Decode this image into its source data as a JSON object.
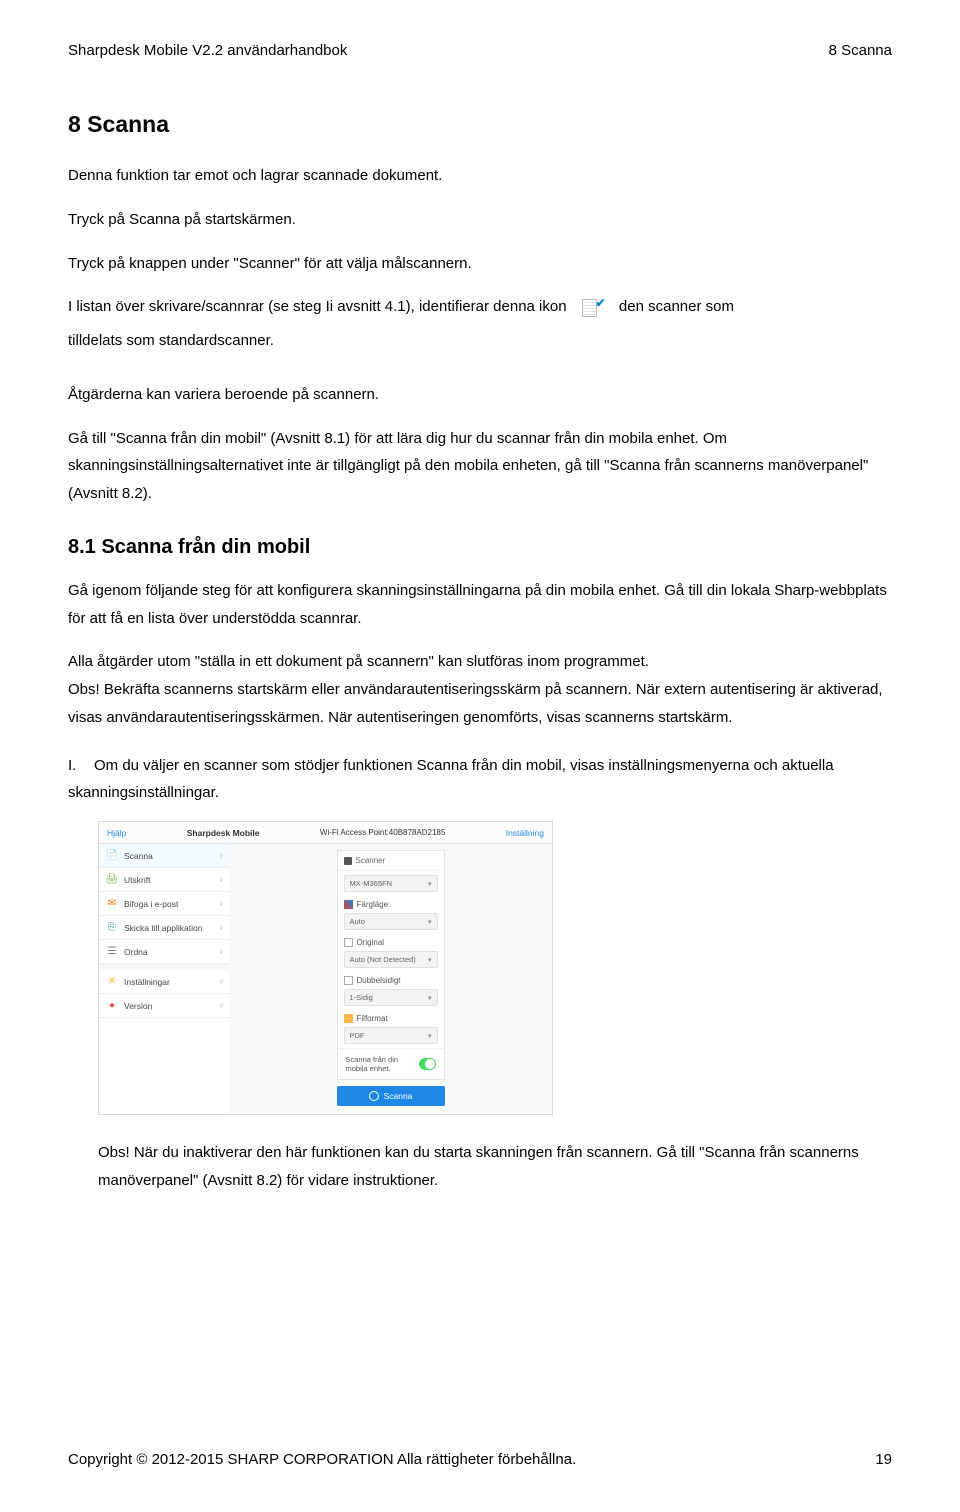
{
  "header": {
    "left": "Sharpdesk Mobile V2.2 användarhandbok",
    "right": "8 Scanna"
  },
  "sec": {
    "h1": "8   Scanna",
    "p1": "Denna funktion tar emot och lagrar scannade dokument.",
    "p2": "Tryck på Scanna på startskärmen.",
    "p3": "Tryck på knappen under \"Scanner\" för att välja målscannern.",
    "p4a": "I listan över skrivare/scannrar (se steg Ii avsnitt 4.1), identifierar denna ikon",
    "p4b": "den scanner som",
    "p4c": "tilldelats som standardscanner.",
    "p5": "Åtgärderna kan variera beroende på scannern.",
    "p6": "Gå till \"Scanna från din mobil\" (Avsnitt 8.1) för att lära dig hur du scannar från din mobila enhet. Om skanningsinställningsalternativet inte är tillgängligt på den mobila enheten, gå till \"Scanna från scannerns manöverpanel\" (Avsnitt 8.2).",
    "h2": "8.1   Scanna från din mobil",
    "p7": "Gå igenom följande steg för att konfigurera skanningsinställningarna på din mobila enhet. Gå till din lokala Sharp-webbplats för att få en lista över understödda scannrar.",
    "p8": "Alla åtgärder utom \"ställa in ett dokument på scannern\" kan slutföras inom programmet.",
    "p9": "Obs! Bekräfta scannerns startskärm eller användarautentiseringsskärm på scannern. När extern autentisering är aktiverad, visas användarautentiseringsskärmen. När autentiseringen genomförts, visas scannerns startskärm.",
    "list1marker": "I.",
    "list1": "Om du väljer en scanner som stödjer funktionen Scanna från din mobil, visas inställningsmenyerna och aktuella skanningsinställningar.",
    "pObs": "Obs! När du inaktiverar den här funktionen kan du starta skanningen från scannern. Gå till \"Scanna från scannerns manöverpanel\" (Avsnitt 8.2) för vidare instruktioner."
  },
  "app": {
    "topbar": {
      "help": "Hjälp",
      "title": "Sharpdesk Mobile",
      "wifi": "Wi-Fi Access Point:40B878AD2185",
      "settings": "Inställning"
    },
    "sidebar": [
      {
        "icon": "📄",
        "label": "Scanna",
        "active": true
      },
      {
        "icon": "🖨",
        "label": "Utskrift"
      },
      {
        "icon": "📧",
        "label": "Bifoga i e-post"
      },
      {
        "icon": "📲",
        "label": "Skicka till applikation"
      },
      {
        "icon": "🗂",
        "label": "Ordna"
      },
      {
        "icon": "✕",
        "label": "Inställningar"
      },
      {
        "icon": "❗",
        "label": "Version"
      }
    ],
    "panel": {
      "head": "Scanner",
      "scanner_value": "MX-M365FN",
      "color_label": "Färgläge:",
      "color_value": "Auto",
      "orig_label": "Original",
      "orig_value": "Auto (Not Detected)",
      "dup_label": "Dubbelsidigt",
      "dup_value": "1-Sidig",
      "fmt_label": "Filformat",
      "fmt_value": "PDF",
      "toggle_label": "Scanna från din mobila enhet.",
      "scan_btn": "Scanna"
    }
  },
  "footer": {
    "left": "Copyright © 2012-2015 SHARP CORPORATION Alla rättigheter förbehållna.",
    "right": "19"
  }
}
